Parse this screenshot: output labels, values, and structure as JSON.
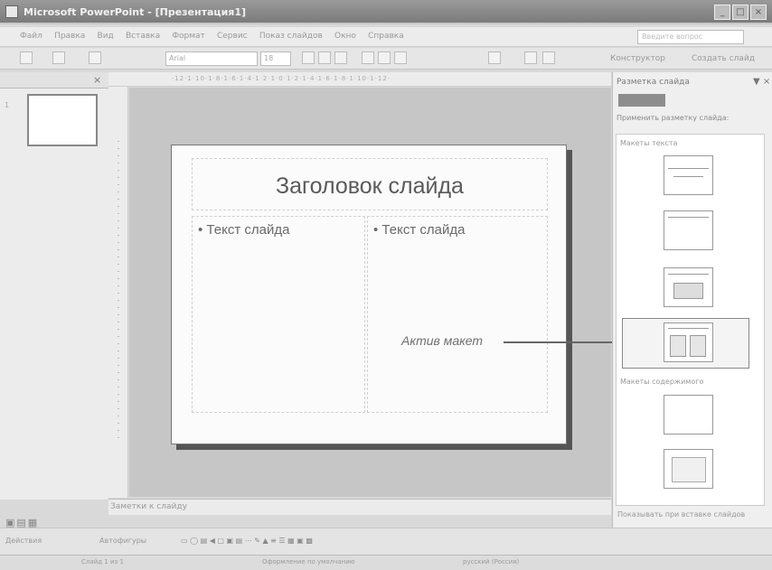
{
  "window": {
    "app_title": "Microsoft PowerPoint",
    "doc_title": "[Презентация1]"
  },
  "menu": [
    "Файл",
    "Правка",
    "Вид",
    "Вставка",
    "Формат",
    "Сервис",
    "Показ слайдов",
    "Окно",
    "Справка"
  ],
  "help_placeholder": "Введите вопрос",
  "format_toolbar": {
    "font": "Arial",
    "size": "18",
    "designer_label": "Конструктор",
    "new_slide_label": "Создать слайд"
  },
  "ruler_text": "·12·1·10·1·8·1·6·1·4·1·2·1·0·1·2·1·4·1·6·1·8·1·10·1·12·",
  "slide_panel": {
    "thumb_number": "1"
  },
  "slide": {
    "title": "Заголовок слайда",
    "left_text": "• Текст слайда",
    "right_text": "• Текст слайда",
    "annotation": "Актив макет"
  },
  "notes_placeholder": "Заметки к слайду",
  "task_pane": {
    "title": "Разметка слайда",
    "apply_label": "Применить разметку слайда:",
    "text_layouts_header": "Макеты текста",
    "content_layouts_header": "Макеты содержимого",
    "show_on_insert": "Показывать при вставке слайдов"
  },
  "drawing_toolbar": {
    "actions_label": "Действия",
    "autoshapes_label": "Автофигуры"
  },
  "status_bar": {
    "slide_count": "Слайд 1 из 1",
    "design": "Оформление по умолчанию",
    "language": "русский (Россия)"
  }
}
